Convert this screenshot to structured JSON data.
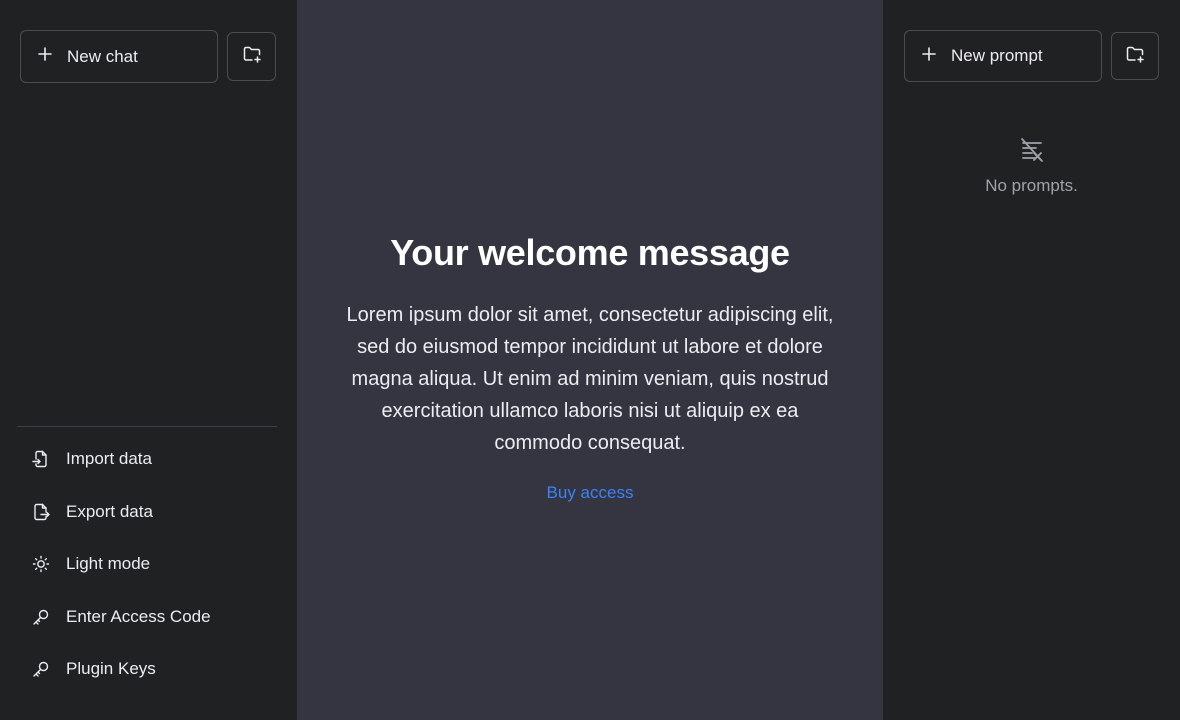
{
  "left_sidebar": {
    "new_chat_label": "New chat",
    "new_chat_icon": "plus-icon",
    "new_folder_icon": "folder-plus-icon",
    "menu": [
      {
        "label": "Import data",
        "icon": "file-import-icon"
      },
      {
        "label": "Export data",
        "icon": "file-export-icon"
      },
      {
        "label": "Light mode",
        "icon": "sun-icon"
      },
      {
        "label": "Enter Access Code",
        "icon": "key-icon"
      },
      {
        "label": "Plugin Keys",
        "icon": "key-icon"
      }
    ]
  },
  "main": {
    "title": "Your welcome message",
    "body": "Lorem ipsum dolor sit amet, consectetur adipiscing elit, sed do eiusmod tempor incididunt ut labore et dolore magna aliqua. Ut enim ad minim veniam, quis nostrud exercitation ullamco laboris nisi ut aliquip ex ea commodo consequat.",
    "link_label": "Buy access",
    "link_color": "#3b82f6"
  },
  "right_sidebar": {
    "new_prompt_label": "New prompt",
    "new_prompt_icon": "plus-icon",
    "new_folder_icon": "folder-plus-icon",
    "empty_icon": "no-prompts-icon",
    "empty_text": "No prompts."
  },
  "colors": {
    "sidebar_bg": "#202123",
    "main_bg": "#343541",
    "border": "#4d4d4f",
    "text": "#ececf1"
  }
}
